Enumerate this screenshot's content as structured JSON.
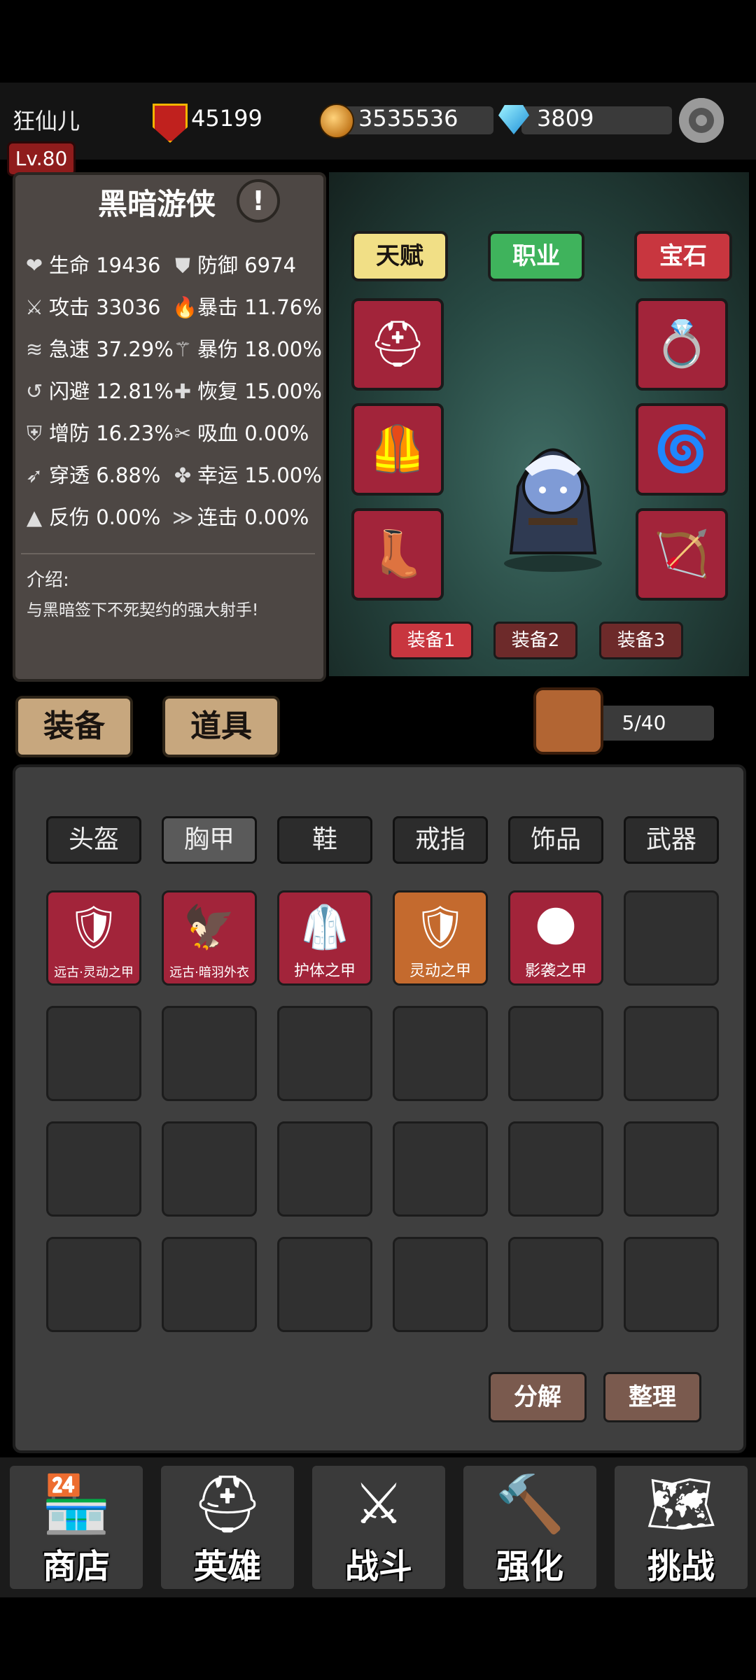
{
  "header": {
    "player_name": "狂仙儿",
    "level": "Lv.80",
    "power": "45199",
    "gold": "3535536",
    "diamonds": "3809"
  },
  "hero": {
    "name": "黑暗游侠",
    "stats": [
      {
        "icon": "heart-icon",
        "label": "生命",
        "value": "19436"
      },
      {
        "icon": "shield-icon",
        "label": "防御",
        "value": "6974"
      },
      {
        "icon": "sword-icon",
        "label": "攻击",
        "value": "33036"
      },
      {
        "icon": "flame-icon",
        "label": "暴击",
        "value": "11.76%"
      },
      {
        "icon": "wind-icon",
        "label": "急速",
        "value": "37.29%"
      },
      {
        "icon": "claw-icon",
        "label": "暴伤",
        "value": "18.00%"
      },
      {
        "icon": "dodge-icon",
        "label": "闪避",
        "value": "12.81%"
      },
      {
        "icon": "heal-icon",
        "label": "恢复",
        "value": "15.00%"
      },
      {
        "icon": "armor-up-icon",
        "label": "增防",
        "value": "16.23%"
      },
      {
        "icon": "drain-icon",
        "label": "吸血",
        "value": "0.00%"
      },
      {
        "icon": "pierce-icon",
        "label": "穿透",
        "value": "6.88%"
      },
      {
        "icon": "clover-icon",
        "label": "幸运",
        "value": "15.00%"
      },
      {
        "icon": "reflect-icon",
        "label": "反伤",
        "value": "0.00%"
      },
      {
        "icon": "combo-icon",
        "label": "连击",
        "value": "0.00%"
      }
    ],
    "intro_label": "介绍:",
    "intro_text": "与黑暗签下不死契约的强大射手!"
  },
  "scene": {
    "talent_label": "天赋",
    "class_label": "职业",
    "gem_label": "宝石",
    "set_buttons": [
      "装备1",
      "装备2",
      "装备3"
    ]
  },
  "tabs": {
    "equipment": "装备",
    "items": "道具"
  },
  "bag": {
    "count": "5/40"
  },
  "filters": [
    "头盔",
    "胸甲",
    "鞋",
    "戒指",
    "饰品",
    "武器"
  ],
  "inventory": [
    {
      "name": "远古·灵动之甲",
      "bg": "#a2243a"
    },
    {
      "name": "远古·暗羽外衣",
      "bg": "#a2243a"
    },
    {
      "name": "护体之甲",
      "bg": "#a2243a"
    },
    {
      "name": "灵动之甲",
      "bg": "#c46a2e"
    },
    {
      "name": "影袭之甲",
      "bg": "#a2243a"
    }
  ],
  "actions": {
    "decompose": "分解",
    "sort": "整理"
  },
  "nav": [
    {
      "label": "商店",
      "icon": "shop-icon"
    },
    {
      "label": "英雄",
      "icon": "helmet-icon"
    },
    {
      "label": "战斗",
      "icon": "crossed-swords-icon"
    },
    {
      "label": "强化",
      "icon": "hammer-icon"
    },
    {
      "label": "挑战",
      "icon": "map-sword-icon"
    }
  ]
}
